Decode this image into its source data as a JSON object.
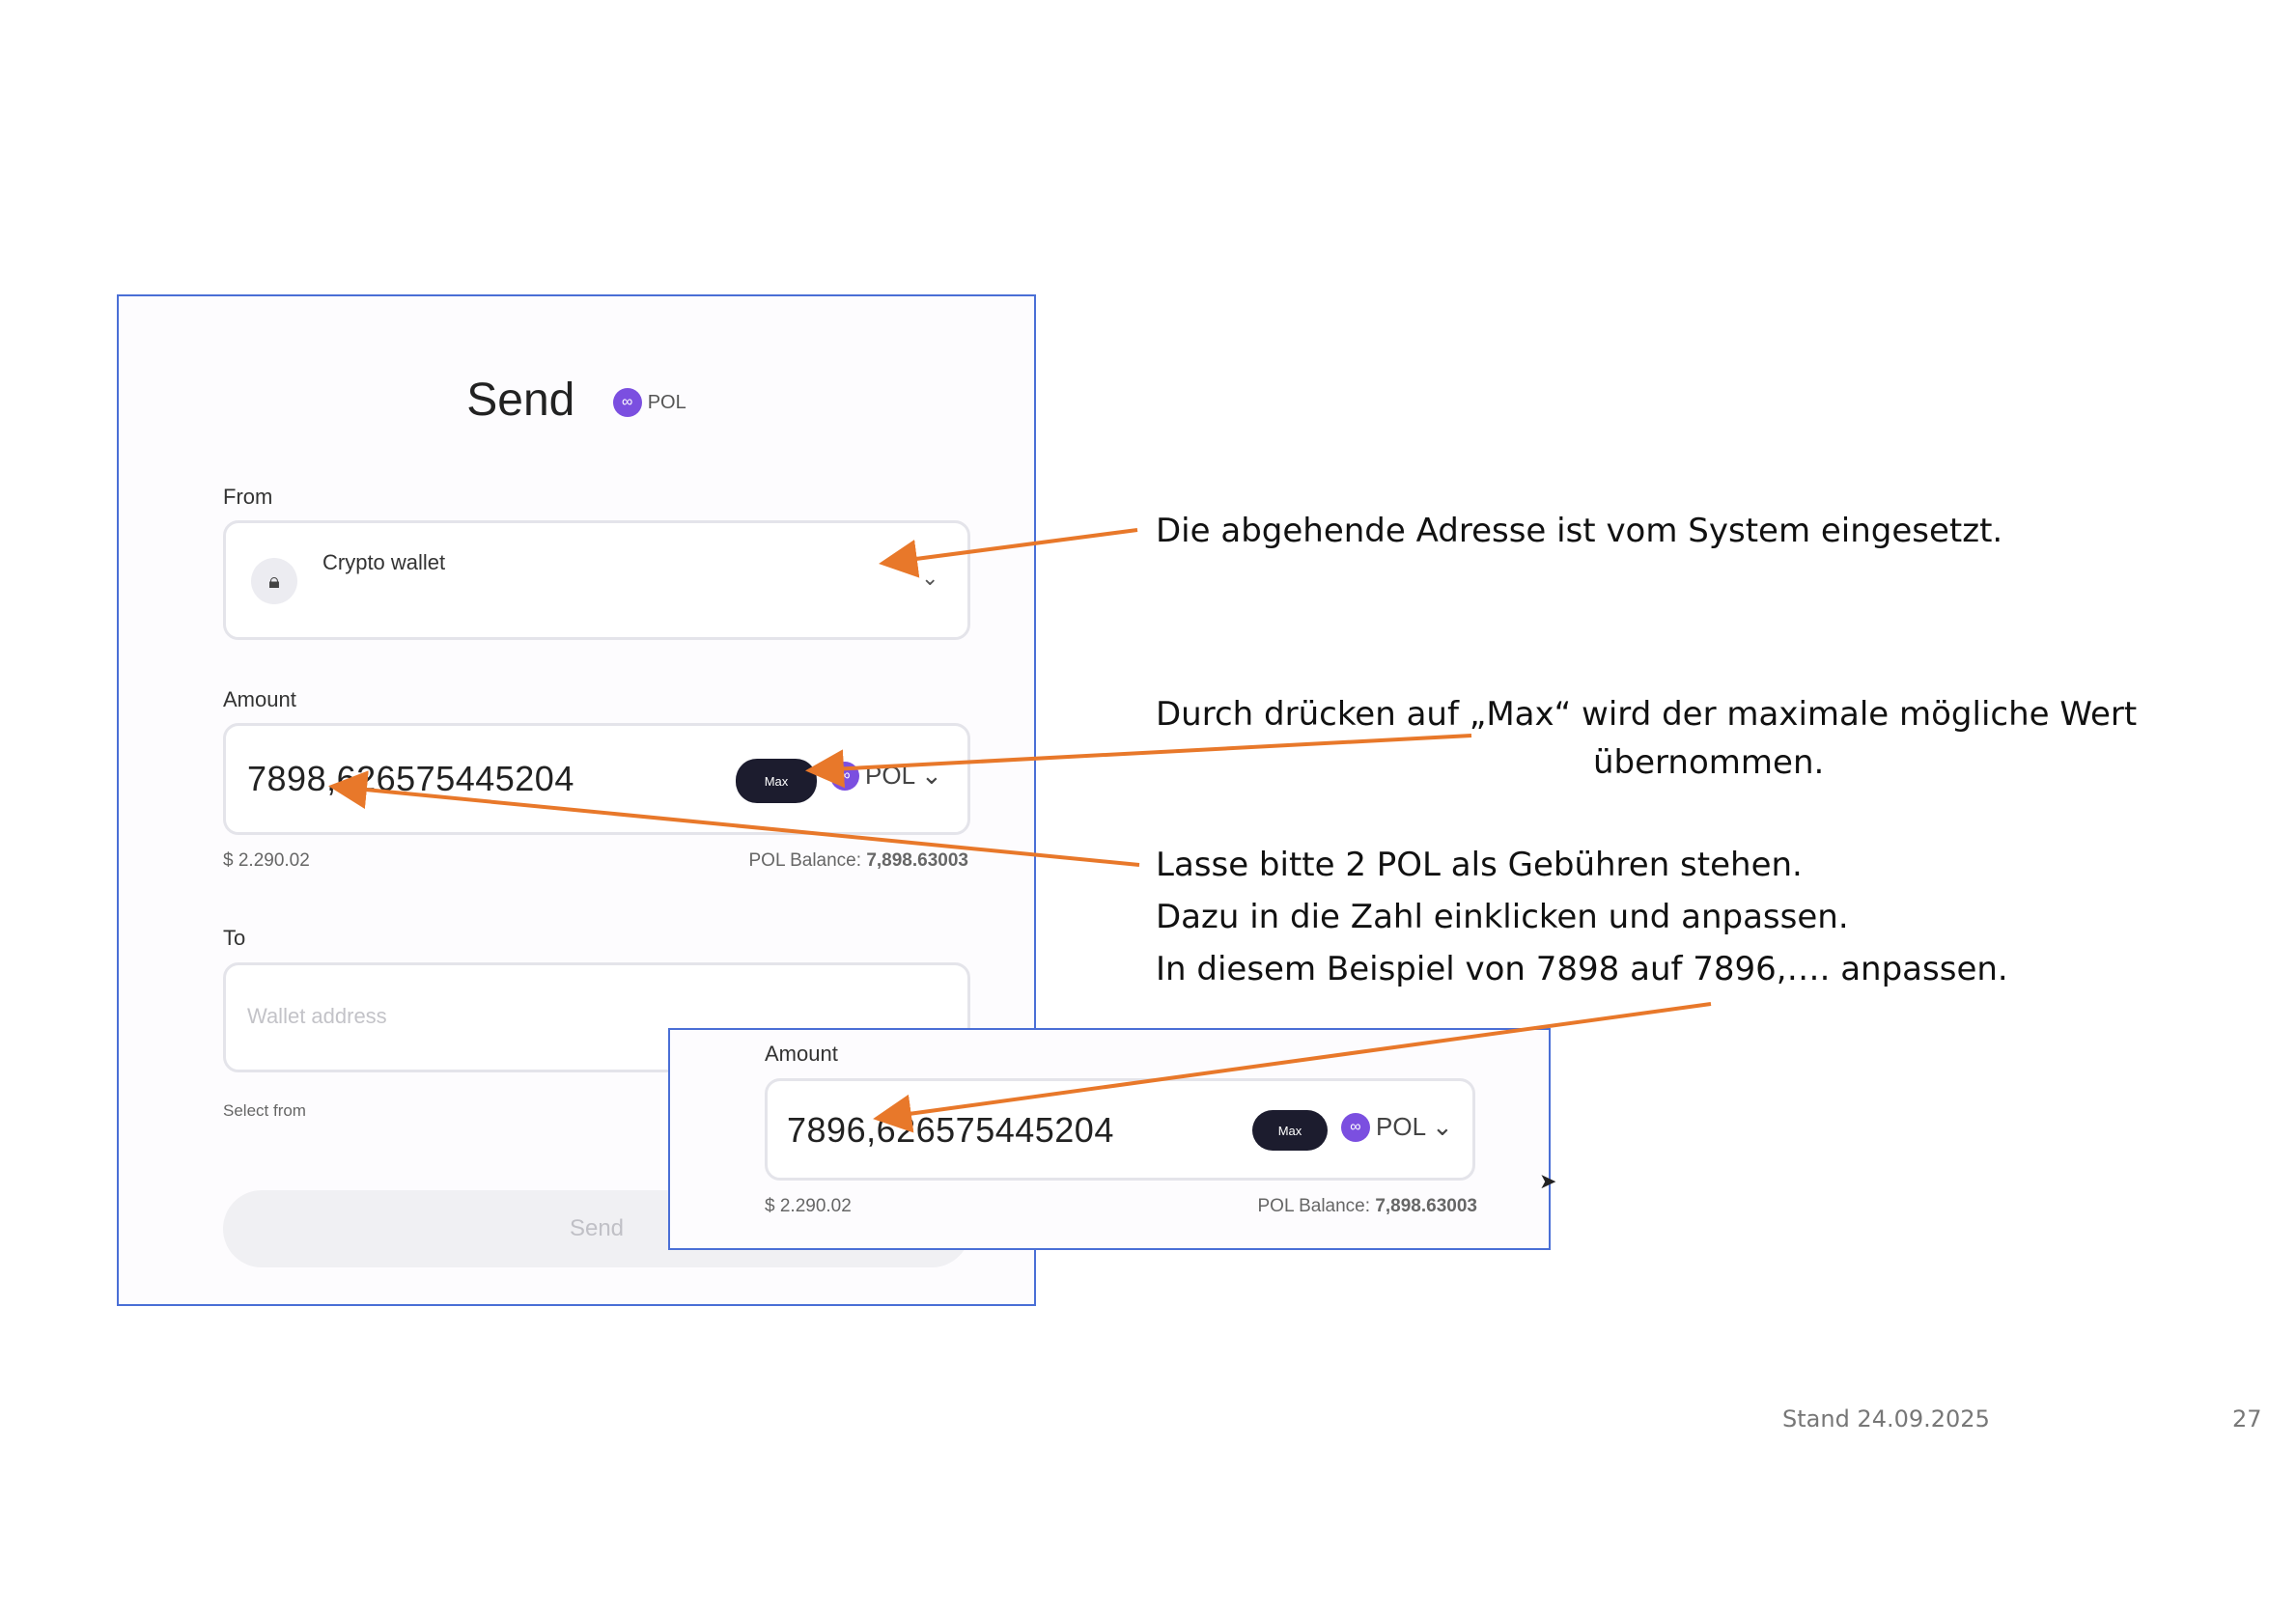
{
  "send_form": {
    "title": "Send",
    "token_label": "POL",
    "from_label": "From",
    "wallet_name": "Crypto wallet",
    "amount_label": "Amount",
    "amount_value": "7898,626575445204",
    "max_label": "Max",
    "token_select": "POL",
    "usd_value": "$ 2.290.02",
    "balance_label": "POL Balance:",
    "balance_value": "7,898.63003",
    "to_label": "To",
    "to_placeholder": "Wallet address",
    "select_from": "Select from",
    "send_button": "Send"
  },
  "inset": {
    "amount_label": "Amount",
    "amount_value": "7896,626575445204",
    "max_label": "Max",
    "token_select": "POL",
    "usd_value": "$ 2.290.02",
    "balance_label": "POL Balance:",
    "balance_value": "7,898.63003"
  },
  "annotations": {
    "a1": "Die abgehende Adresse ist vom System eingesetzt.",
    "a2_line1": "Durch drücken auf „Max“ wird der maximale mögliche Wert",
    "a2_line2": "übernommen.",
    "a3_line1": "Lasse bitte 2 POL als Gebühren stehen.",
    "a3_line2": "Dazu in die Zahl einklicken und anpassen.",
    "a3_line3": "In diesem Beispiel von 7898 auf 7896,…. anpassen."
  },
  "footer": {
    "stand": "Stand 24.09.2025",
    "page": "27"
  },
  "colors": {
    "arrow": "#e8782a",
    "frame_border": "#4a6fd6",
    "token": "#7b4fe0",
    "max_button": "#1c1c2e"
  },
  "icons": [
    "polygon-token-icon",
    "wallet-icon",
    "chevron-down-icon",
    "mouse-cursor-icon"
  ]
}
